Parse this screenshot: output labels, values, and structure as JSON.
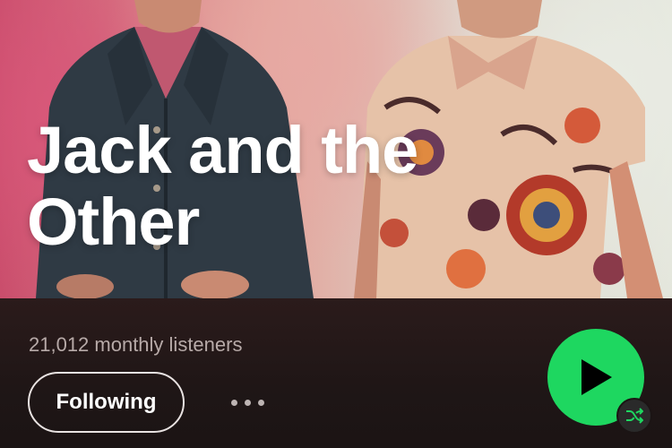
{
  "artist": {
    "name": "Jack and the Other",
    "monthly_listeners": "21,012 monthly listeners"
  },
  "actions": {
    "follow_label": "Following",
    "more_icon": "more-horizontal-icon",
    "play_icon": "play-icon",
    "shuffle_icon": "shuffle-icon"
  },
  "colors": {
    "accent_green": "#1ed760",
    "panel_bg": "#1e1414",
    "text_primary": "#ffffff",
    "text_secondary": "#b7aaa8"
  }
}
